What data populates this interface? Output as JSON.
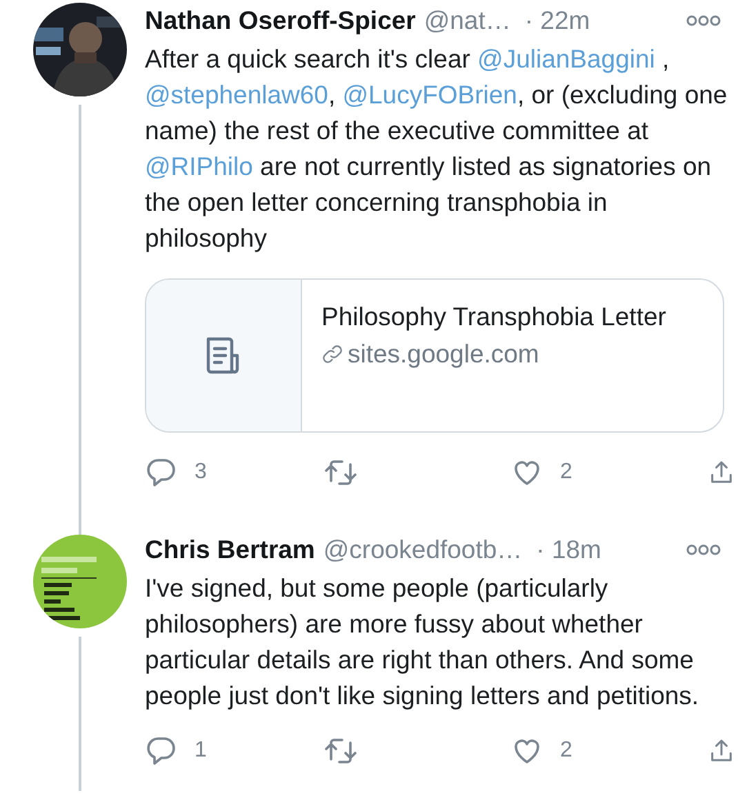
{
  "tweets": [
    {
      "author": "Nathan Oseroff-Spicer",
      "handle": "@nat…",
      "time": "· 22m",
      "body": [
        {
          "kind": "text",
          "text": "After a quick search it's clear "
        },
        {
          "kind": "mention",
          "text": "@JulianBaggini"
        },
        {
          "kind": "text",
          "text": " , "
        },
        {
          "kind": "mention",
          "text": "@stephenlaw60"
        },
        {
          "kind": "text",
          "text": ", "
        },
        {
          "kind": "mention",
          "text": "@LucyFOBrien"
        },
        {
          "kind": "text",
          "text": ", or (excluding one name) the rest of the executive committee at "
        },
        {
          "kind": "mention",
          "text": "@RIPhilo"
        },
        {
          "kind": "text",
          "text": " are not currently listed as signatories on the open letter concerning transphobia in philosophy"
        }
      ],
      "card": {
        "title": "Philosophy Transphobia Letter",
        "domain": "sites.google.com"
      },
      "actions": [
        {
          "kind": "reply",
          "count": "3"
        },
        {
          "kind": "retweet"
        },
        {
          "kind": "like",
          "count": "2"
        },
        {
          "kind": "share"
        }
      ]
    },
    {
      "avatar": {
        "kind": "cover"
      },
      "author": "Chris Bertram",
      "handle": "@crookedfootb…",
      "time": "· 18m",
      "body": [
        {
          "kind": "text",
          "text": "I've signed, but some people (particularly philosophers) are more fussy about whether particular details are right than others. And some people just don't like signing letters and petitions."
        }
      ],
      "actions": [
        {
          "kind": "reply",
          "count": "1"
        },
        {
          "kind": "retweet"
        },
        {
          "kind": "like",
          "count": "2"
        },
        {
          "kind": "share"
        }
      ]
    }
  ]
}
